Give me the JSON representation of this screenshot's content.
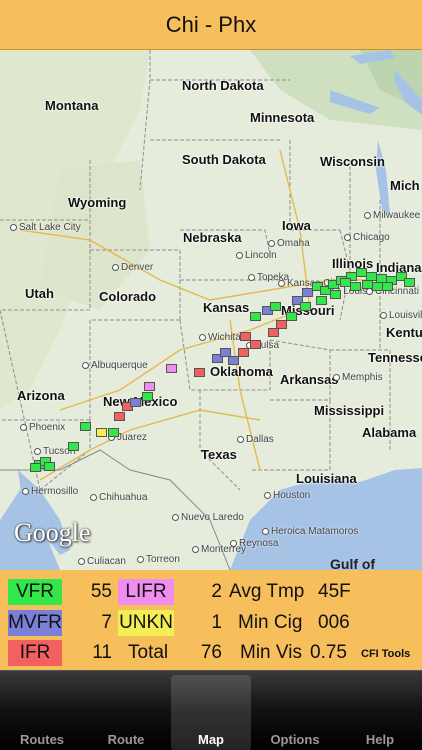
{
  "header": {
    "title": "Chi - Phx"
  },
  "map": {
    "states": [
      "North Dakota",
      "Montana",
      "Minnesota",
      "South Dakota",
      "Wisconsin",
      "Wyoming",
      "Iowa",
      "Nebraska",
      "Illinois",
      "Indiana",
      "Utah",
      "Colorado",
      "Kansas",
      "Missouri",
      "Kentu",
      "Oklahoma",
      "Arkansas",
      "Arizona",
      "New Mexico",
      "Tennessee",
      "Mississippi",
      "Alabama",
      "Texas",
      "Louisiana",
      "Mich"
    ],
    "cities": [
      "Salt Lake City",
      "Omaha",
      "Lincoln",
      "Denver",
      "Topeka",
      "Kansas City",
      "St Louis",
      "Cincinnati",
      "Chicago",
      "Milwaukee",
      "Wichita",
      "Tulsa",
      "Albuquerque",
      "Phoenix",
      "Tucson",
      "Juarez",
      "Dallas",
      "Hermosillo",
      "Chihuahua",
      "Nuevo Laredo",
      "Monterrey",
      "Houston",
      "Culiacan",
      "Torreon",
      "Reynosa",
      "Heroica Matamoros",
      "Memphis",
      "Louisville"
    ],
    "gulf": "Gulf of",
    "watermark": "Google"
  },
  "stats": {
    "vfr": {
      "label": "VFR",
      "value": "55",
      "color": "#33e64a"
    },
    "mvfr": {
      "label": "MVFR",
      "value": "7",
      "color": "#7b7fd8"
    },
    "ifr": {
      "label": "IFR",
      "value": "11",
      "color": "#f36060"
    },
    "lifr": {
      "label": "LIFR",
      "value": "2",
      "color": "#ef8ef0"
    },
    "unkn": {
      "label": "UNKN",
      "value": "1",
      "color": "#f4ee55"
    },
    "total": {
      "label": "Total",
      "value": "76"
    },
    "avg_tmp": {
      "label": "Avg Tmp",
      "value": "45F"
    },
    "min_cig": {
      "label": "Min Cig",
      "value": "006"
    },
    "min_vis": {
      "label": "Min Vis",
      "value": "0.75"
    },
    "cfi_tools": "CFI Tools"
  },
  "tabs": [
    {
      "label": "Routes",
      "icon": "list-icon"
    },
    {
      "label": "Route",
      "icon": "route-icon"
    },
    {
      "label": "Map",
      "icon": "map-icon",
      "active": true
    },
    {
      "label": "Options",
      "icon": "options-icon"
    },
    {
      "label": "Help",
      "icon": "help-icon"
    }
  ]
}
